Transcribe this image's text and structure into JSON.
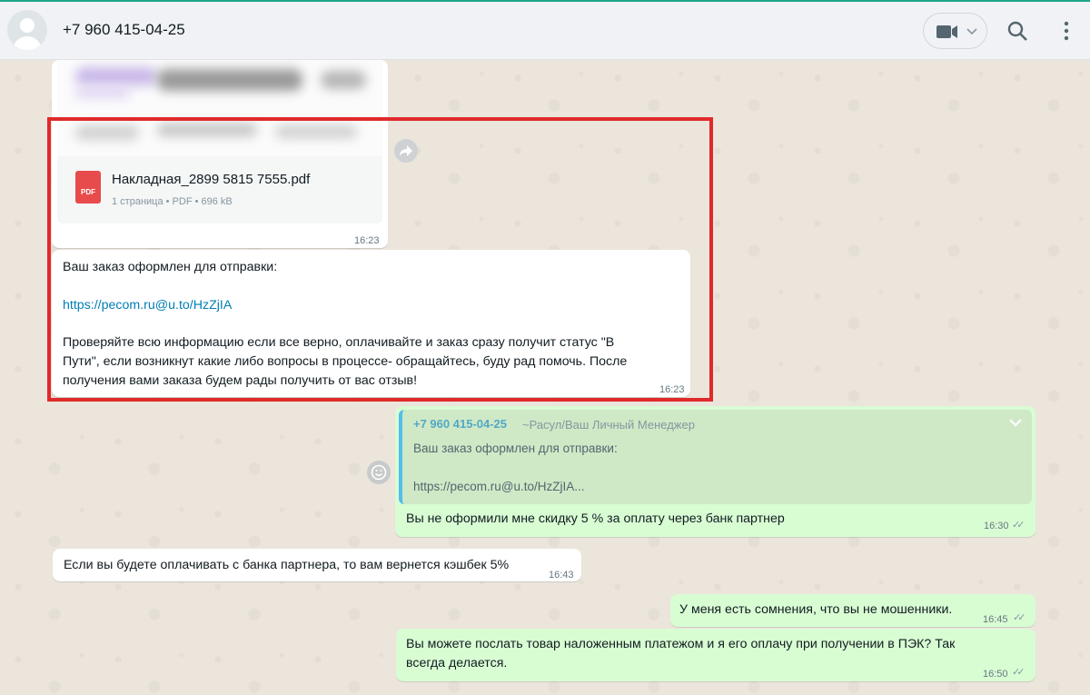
{
  "header": {
    "contact_name": "+7 960 415-04-25",
    "icons": [
      "avatar",
      "video-icon",
      "chevron-down-icon",
      "search-icon",
      "kebab-menu-icon"
    ]
  },
  "messages": {
    "document": {
      "file_name": "Накладная_2899 5815 7555.pdf",
      "file_type_badge": "PDF",
      "meta": "1 страница • PDF • 696 kB",
      "time": "16:23"
    },
    "order": {
      "line1": "Ваш заказ оформлен для отправки:",
      "link": "https://pecom.ru@u.to/HzZjIA",
      "para1": "Проверяйте всю информацию если все верно, оплачивайте и заказ сразу получит статус \"В",
      "para2": "Пути\", если возникнут какие либо вопросы в процессе- обращайтесь, буду рад помочь. После",
      "para3": "получения вами заказа будем рады получить от вас отзыв!",
      "time": "16:23"
    },
    "reply": {
      "quote_author": "+7 960 415-04-25",
      "quote_sub": "~Расул/Ваш Личный Менеджер",
      "quote_line1": "Ваш заказ оформлен для отправки:",
      "quote_line2": "https://pecom.ru@u.to/HzZjIA...",
      "text": "Вы не оформили мне скидку 5 % за оплату через банк партнер",
      "time": "16:30"
    },
    "cashback": {
      "text": "Если вы будете оплачивать с банка партнера, то вам вернется кэшбек 5%",
      "time": "16:43"
    },
    "doubt": {
      "text": "У меня есть сомнения, что вы не мошенники.",
      "time": "16:45"
    },
    "cod": {
      "line1": "Вы можете послать товар наложенным платежом и я его оплачу при получении в ПЭК? Так",
      "line2": "всегда делается.",
      "time": "16:50"
    }
  },
  "colors": {
    "incoming_bubble": "#ffffff",
    "outgoing_bubble": "#d9fdd3",
    "highlight_box": "#e02a2a",
    "link": "#027eb5"
  }
}
